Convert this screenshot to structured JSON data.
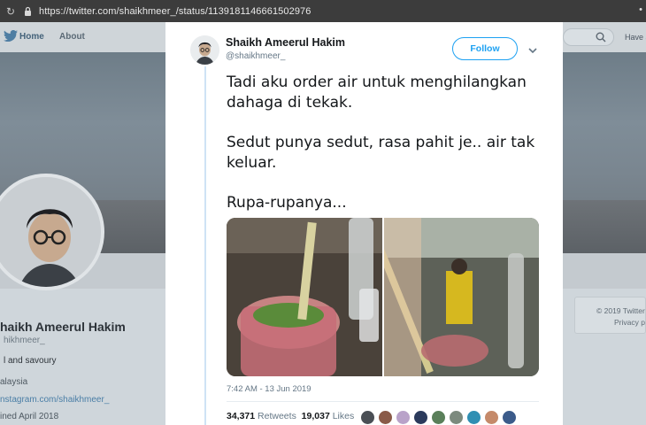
{
  "browser": {
    "url": "https://twitter.com/shaikhmeer_/status/1139181146661502976"
  },
  "nav": {
    "home_label": "Home",
    "about_label": "About",
    "have_account": "Have a"
  },
  "profile": {
    "name": "haikh Ameerul Hakim",
    "handle": "hikhmeer_",
    "bio": "l and savoury",
    "location": "alaysia",
    "link": "nstagram.com/shaikhmeer_",
    "joined": "ined April 2018"
  },
  "sidebar_right": {
    "copyright": "© 2019 Twitter",
    "privacy": "Privacy p"
  },
  "tweet": {
    "author_name": "Shaikh Ameerul Hakim",
    "author_handle": "@shaikhmeer_",
    "follow_label": "Follow",
    "paragraphs": [
      "Tadi aku order air untuk menghilangkan dahaga di tekak.",
      "Sedut punya sedut, rasa pahit je.. air tak keluar.",
      "Rupa-rupanya..."
    ],
    "timestamp": "7:42 AM - 13 Jun 2019",
    "retweets_count": "34,371",
    "retweets_label": "Retweets",
    "likes_count": "19,037",
    "likes_label": "Likes",
    "liker_colors": [
      "#4a4f55",
      "#8a5a48",
      "#b9a2c9",
      "#2b3a5c",
      "#5a7f5a",
      "#7c8a7e",
      "#2f8fb3",
      "#c58a6a",
      "#3b5b8a"
    ]
  },
  "colors": {
    "accent": "#1da1f2",
    "text": "#14171a",
    "muted": "#657786"
  }
}
